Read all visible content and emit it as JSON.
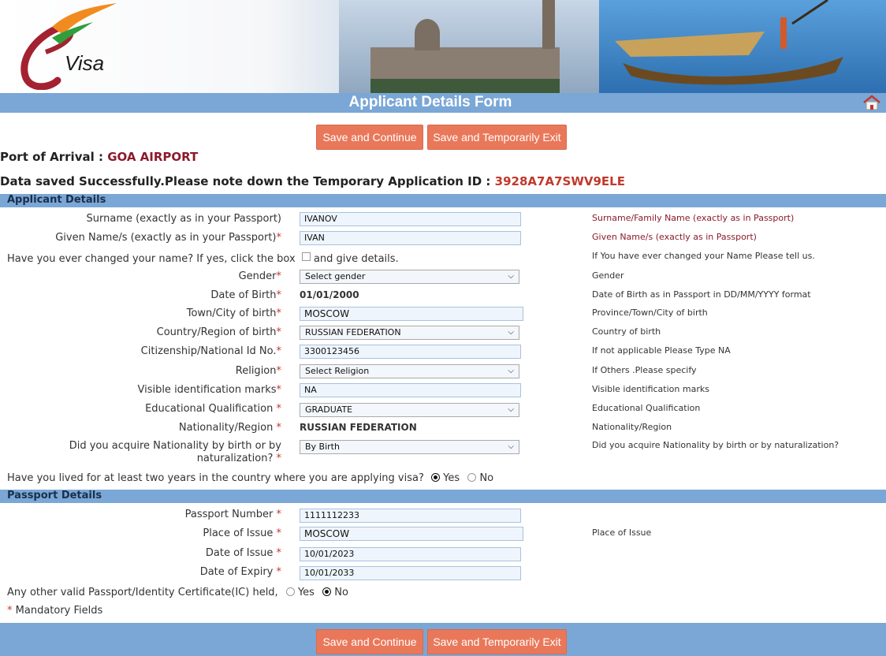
{
  "header": {
    "logo_text": "Visa",
    "title": "Applicant Details Form"
  },
  "buttons": {
    "save_continue": "Save and Continue",
    "save_exit": "Save and Temporarily Exit"
  },
  "arrival": {
    "label": "Port of Arrival :",
    "value": "GOA AIRPORT"
  },
  "saved_msg": {
    "text": "Data saved Successfully.Please note down the Temporary Application ID :",
    "app_id": "3928A7A7SWV9ELE"
  },
  "applicant": {
    "section_title": "Applicant Details",
    "surname": {
      "label": "Surname (exactly as in your Passport)",
      "value": "IVANOV",
      "hint": "Surname/Family Name (exactly as in Passport)"
    },
    "given_name": {
      "label": "Given Name/s (exactly as in your Passport)",
      "value": "IVAN",
      "hint": "Given Name/s (exactly as in Passport)"
    },
    "changed_name": {
      "label": "Have you ever changed your name? If yes, click the box",
      "after": "and give details.",
      "hint": "If You have ever changed your Name Please tell us."
    },
    "gender": {
      "label": "Gender",
      "value": "Select gender",
      "hint": "Gender"
    },
    "dob": {
      "label": "Date of Birth",
      "value": "01/01/2000",
      "hint": "Date of Birth as in Passport in DD/MM/YYYY format"
    },
    "town": {
      "label": "Town/City of birth",
      "value": "MOSCOW",
      "hint": "Province/Town/City of birth"
    },
    "country": {
      "label": "Country/Region of birth",
      "value": "RUSSIAN FEDERATION",
      "hint": "Country of birth"
    },
    "national_id": {
      "label": "Citizenship/National Id No.",
      "value": "3300123456",
      "hint": "If not applicable Please Type NA"
    },
    "religion": {
      "label": "Religion",
      "value": "Select Religion",
      "hint": "If Others .Please specify"
    },
    "marks": {
      "label": "Visible identification marks",
      "value": "NA",
      "hint": "Visible identification marks"
    },
    "education": {
      "label": "Educational Qualification ",
      "value": "GRADUATE",
      "hint": "Educational Qualification"
    },
    "nationality": {
      "label": "Nationality/Region ",
      "value": "RUSSIAN FEDERATION",
      "hint": "Nationality/Region"
    },
    "acquire": {
      "label_line1": "Did you acquire Nationality by birth or by",
      "label_line2": "naturalization? ",
      "value": "By Birth",
      "hint": "Did you acquire Nationality by birth or by naturalization?"
    },
    "two_years": {
      "label": "Have you lived for at least two years in the country where you are applying visa?",
      "yes": "Yes",
      "no": "No",
      "selected": "Yes"
    }
  },
  "passport": {
    "section_title": "Passport Details",
    "number": {
      "label": "Passport Number ",
      "value": "1111112233"
    },
    "place": {
      "label": "Place of Issue ",
      "value": "MOSCOW",
      "hint": "Place of Issue"
    },
    "issue_date": {
      "label": "Date of Issue ",
      "value": "10/01/2023"
    },
    "expiry_date": {
      "label": "Date of Expiry ",
      "value": "10/01/2033"
    },
    "other": {
      "label": "Any other valid Passport/Identity Certificate(IC) held,",
      "yes": "Yes",
      "no": "No",
      "selected": "No"
    }
  },
  "mandatory": {
    "star": "*",
    "text": "Mandatory Fields"
  },
  "required_star": "*",
  "colors": {
    "accent_bar": "#7aa7d6",
    "button": "#e9785a",
    "highlight": "#8b1a2b"
  }
}
